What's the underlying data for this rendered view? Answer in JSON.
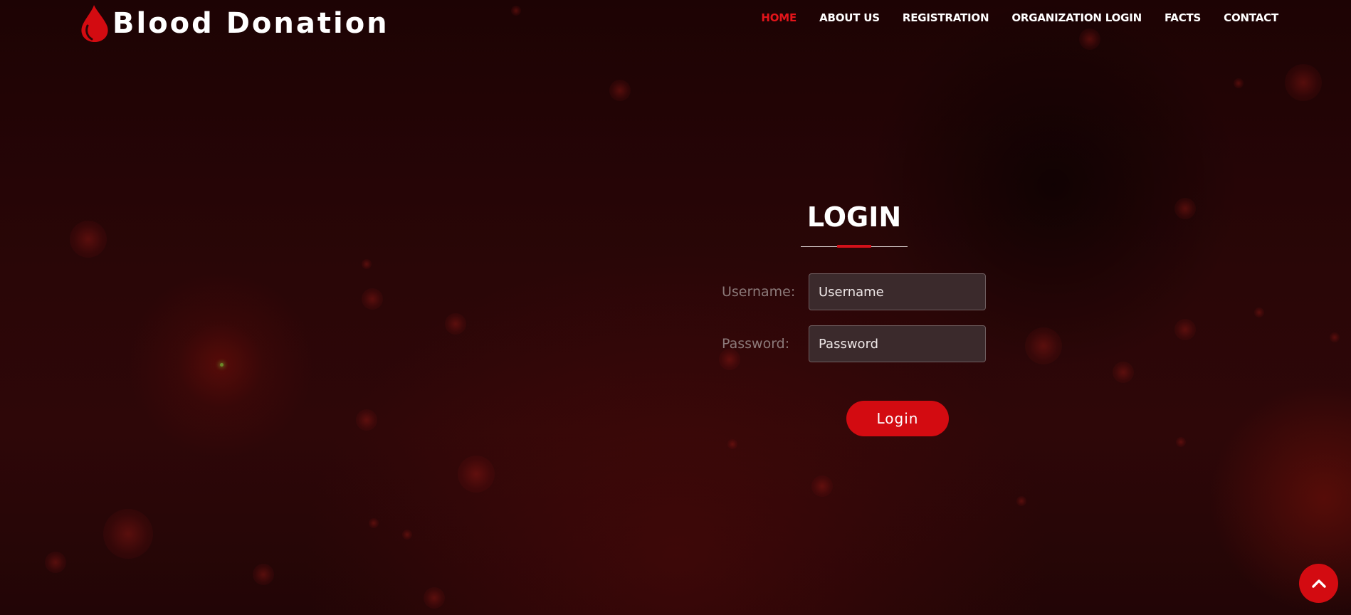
{
  "header": {
    "logo_text": "Blood Donation",
    "nav": [
      {
        "label": "HOME",
        "active": true
      },
      {
        "label": "ABOUT US",
        "active": false
      },
      {
        "label": "REGISTRATION",
        "active": false
      },
      {
        "label": "ORGANIZATION LOGIN",
        "active": false
      },
      {
        "label": "FACTS",
        "active": false
      },
      {
        "label": "CONTACT",
        "active": false
      }
    ]
  },
  "login": {
    "title": "LOGIN",
    "username_label": "Username:",
    "username_placeholder": "Username",
    "password_label": "Password:",
    "password_placeholder": "Password",
    "submit_label": "Login"
  },
  "icons": {
    "logo": "blood-drop-icon",
    "scroll_top": "chevron-up-icon"
  },
  "colors": {
    "accent": "#d30b11",
    "active_nav": "#e3141a",
    "background": "#2a0607"
  }
}
